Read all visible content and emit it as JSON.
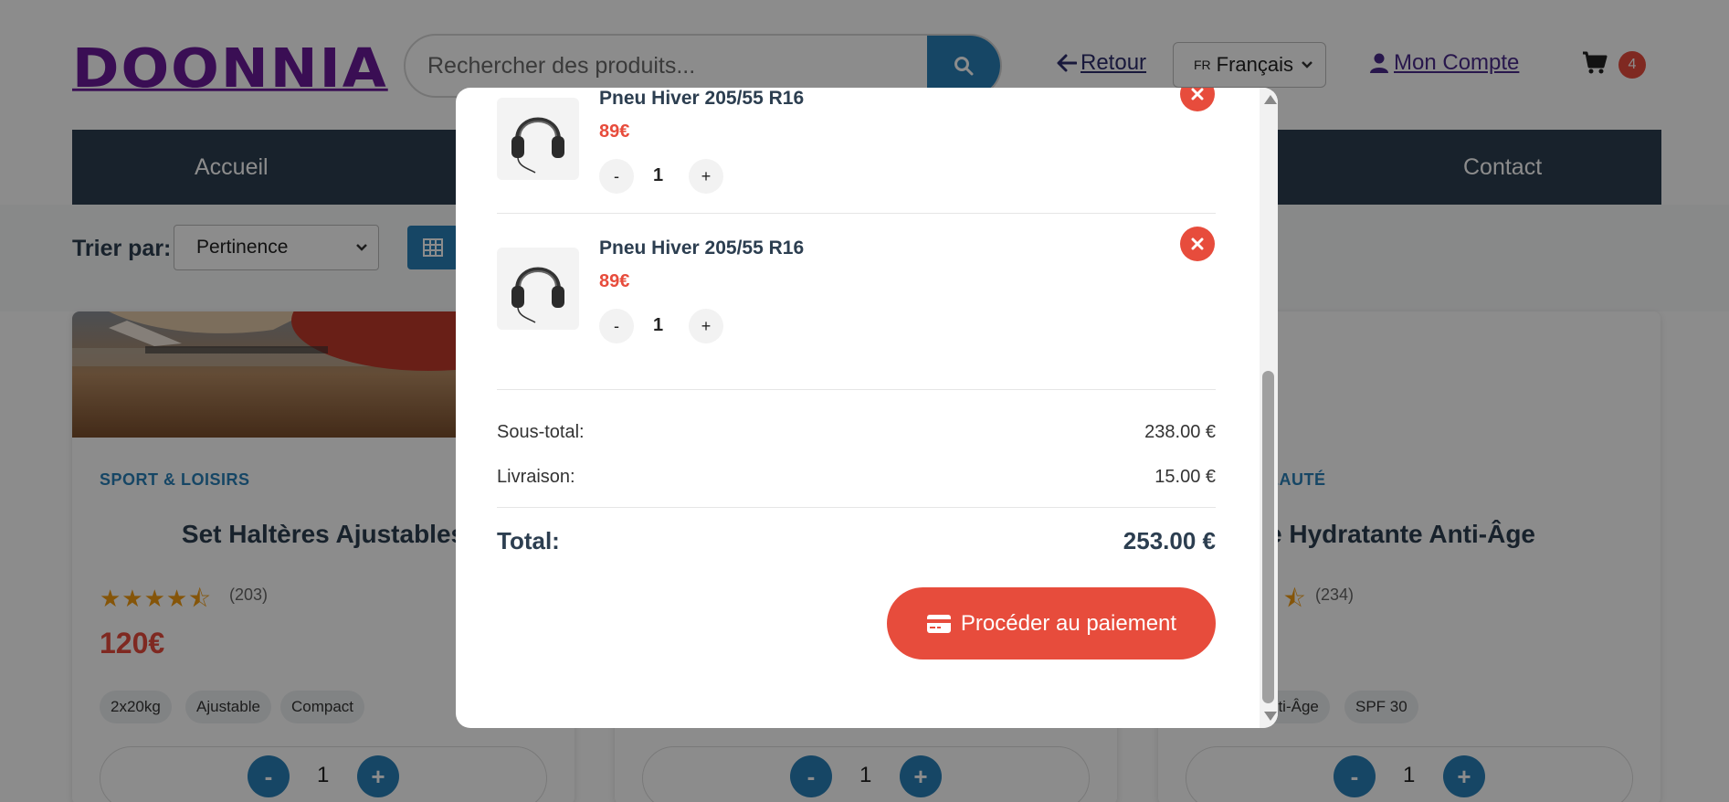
{
  "header": {
    "logo": "DOONNIA",
    "search_placeholder": "Rechercher des produits...",
    "back_label": "Retour",
    "language_code": "FR",
    "language_label": "Français",
    "account_label": "Mon Compte",
    "cart_count": "4"
  },
  "nav": {
    "items": [
      {
        "label": "Accueil"
      },
      {
        "label": "Contact"
      }
    ]
  },
  "toolbar": {
    "sort_label": "Trier par:",
    "sort_value": "Pertinence"
  },
  "products": [
    {
      "category": "SPORT & LOISIRS",
      "title": "Set Haltères Ajustables",
      "stars": "★★★★⯪",
      "reviews": "(203)",
      "price": "120€",
      "tags": [
        "2x20kg",
        "Ajustable",
        "Compact"
      ],
      "qty": "1"
    },
    {
      "qty": "1"
    },
    {
      "category": "EAUTÉ",
      "title": "e Hydratante Anti-Âge",
      "stars": "⯪",
      "reviews": "(234)",
      "tags": [
        "nti-Âge",
        "SPF 30"
      ],
      "qty": "1"
    }
  ],
  "cart_modal": {
    "items": [
      {
        "name": "Pneu Hiver 205/55 R16",
        "price": "89€",
        "qty": "1"
      },
      {
        "name": "Pneu Hiver 205/55 R16",
        "price": "89€",
        "qty": "1"
      }
    ],
    "subtotal_label": "Sous-total:",
    "subtotal_value": "238.00 €",
    "shipping_label": "Livraison:",
    "shipping_value": "15.00 €",
    "total_label": "Total:",
    "total_value": "253.00 €",
    "checkout_label": "Procéder au paiement",
    "minus_label": "-",
    "plus_label": "+"
  },
  "colors": {
    "accent_blue": "#2980b9",
    "accent_red": "#e74c3c",
    "nav_bg": "#2c3e50",
    "logo": "#6a1b9a"
  }
}
